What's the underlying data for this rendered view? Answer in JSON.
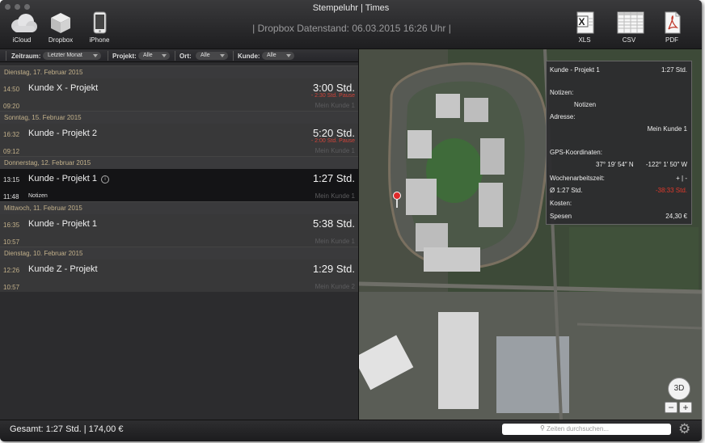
{
  "window": {
    "title": "Stempeluhr | Times"
  },
  "toolbar": {
    "icloud_label": "iCloud",
    "dropbox_label": "Dropbox",
    "iphone_label": "iPhone",
    "xls_label": "XLS",
    "csv_label": "CSV",
    "pdf_label": "PDF"
  },
  "status": {
    "dropbox_status": "| Dropbox Datenstand: 06.03.2015 16:26 Uhr |"
  },
  "filters": {
    "zeitraum_label": "Zeitraum:",
    "zeitraum_value": "Letzter Monat",
    "projekt_label": "Projekt:",
    "projekt_value": "Alle",
    "ort_label": "Ort:",
    "ort_value": "Alle",
    "kunde_label": "Kunde:",
    "kunde_value": "Alle"
  },
  "days": [
    {
      "date": "Dienstag, 17. Februar 2015",
      "entries": [
        {
          "start": "14:50",
          "end": "09:20",
          "project": "Kunde X - Projekt",
          "duration": "3:00 Std.",
          "pause": "- 2:30 Std. Pause",
          "customer": "Mein Kunde 1"
        }
      ]
    },
    {
      "date": "Sonntag, 15. Februar 2015",
      "entries": [
        {
          "start": "16:32",
          "end": "09:12",
          "project": "Kunde - Projekt 2",
          "duration": "5:20 Std.",
          "pause": "- 2:00 Std. Pause",
          "customer": "Mein Kunde 1"
        }
      ]
    },
    {
      "date": "Donnerstag, 12. Februar 2015",
      "entries": [
        {
          "start": "13:15",
          "end": "11:48",
          "project": "Kunde - Projekt 1",
          "duration": "1:27 Std.",
          "note": "Notizen",
          "customer": "Mein Kunde 1",
          "selected": true,
          "info_icon": "i"
        }
      ]
    },
    {
      "date": "Mittwoch, 11. Februar 2015",
      "entries": [
        {
          "start": "16:35",
          "end": "10:57",
          "project": "Kunde - Projekt 1",
          "duration": "5:38 Std.",
          "customer": "Mein Kunde 1"
        }
      ]
    },
    {
      "date": "Dienstag, 10. Februar 2015",
      "entries": [
        {
          "start": "12:26",
          "end": "10:57",
          "project": "Kunde Z - Projekt",
          "duration": "1:29 Std.",
          "customer": "Mein Kunde 2"
        }
      ]
    }
  ],
  "detail": {
    "project": "Kunde - Projekt 1",
    "duration": "1:27 Std.",
    "notes_label": "Notizen:",
    "notes_value": "Notizen",
    "address_label": "Adresse:",
    "address_value": "Mein Kunde 1",
    "gps_label": "GPS-Koordinaten:",
    "gps_lat": "37° 19′ 54″ N",
    "gps_lon": "-122° 1′ 50″ W",
    "week_label": "Wochenarbeitszeit:",
    "week_buttons": "+ | -",
    "avg_label": "Ø 1:27 Std.",
    "avg_value": "-38:33 Std.",
    "costs_label": "Kosten:",
    "spesen_label": "Spesen",
    "spesen_value": "24,30 €"
  },
  "map": {
    "btn_3d": "3D",
    "zoom_out": "−",
    "zoom_in": "+"
  },
  "footer": {
    "total": "Gesamt: 1:27 Std. | 174,00 €",
    "search_placeholder": "Zeiten durchsuchen..."
  },
  "colors": {
    "time_accent": "#c2b08a",
    "pause_red": "#d0443a",
    "negative_red": "#e0392b"
  }
}
